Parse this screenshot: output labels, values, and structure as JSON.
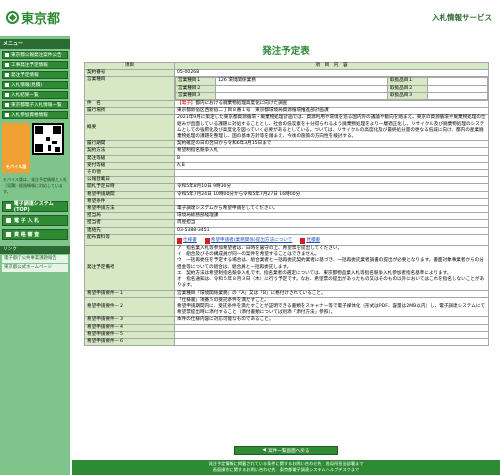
{
  "header": {
    "logo_text": "東京都",
    "service_title": "入札情報サービス"
  },
  "sidebar": {
    "menu_label": "メニュー",
    "items": [
      {
        "label": "東京都公報発注案件公告"
      },
      {
        "label": "工事発注予定情報"
      },
      {
        "label": "発注予定情報"
      },
      {
        "label": "入札情報(見積)"
      },
      {
        "label": "入札結果一覧"
      },
      {
        "label": "東京都電子入札情報一覧"
      },
      {
        "label": "入札参加資格情報"
      }
    ],
    "mobile_label": "モバイル版",
    "qr_note": "モバイル版は、発注予定情報と入札（見積）経過情報に対応しています。",
    "big_buttons": [
      "電子調達システム(TOP)",
      "電 子 入 札",
      "資 格 審 査"
    ],
    "link_head": "リンク",
    "links": [
      "電子都庁公共事業課題報告",
      "東京都公式ホームページ"
    ]
  },
  "main": {
    "title": "発注予定表",
    "col_item": "項目",
    "col_content": "項　目　内　容",
    "rows": {
      "contract_no": {
        "label": "契約番号",
        "value": "05-00268"
      },
      "business_type": {
        "label": "営業種目",
        "cells": [
          {
            "lbl": "営業種目１",
            "val": "126 環境関係業務",
            "lbl2": "取扱品目１",
            "val2": ""
          },
          {
            "lbl": "営業種目２",
            "val": "",
            "lbl2": "取扱品目２",
            "val2": ""
          },
          {
            "lbl": "営業種目３",
            "val": "",
            "lbl2": "取扱品目３",
            "val2": ""
          }
        ]
      },
      "subject": {
        "label": "件　名",
        "tag": "【電子】",
        "value": "都内における廃棄物処理高度化に向けた調査"
      },
      "location": {
        "label": "履行場所",
        "value": "東京都新宿区西新宿二丁目８番１号　東京都環境局資源循環推進部計画課"
      },
      "overview": {
        "label": "概要",
        "value": "2021年9月に策定した東京都資源循環・廃棄物処理計画では、資源利用や環境を巡る国内外の議論や動向を踏まえ、東京の資源循環や廃棄物処理の仕組みが直面している課題に対処することとし、社会の低炭素を十分得られるよう廃棄物処理をより一層適正化し、リサイクル及び廃棄物処理のシステムとしての強靭化及び高度化を図っていく必要があるとしている。ついては、リサイクルの高度化及び最終処分量の更なる低減に向け、都内の産業廃棄物処理の課題を整理し、国の基本方針等を踏まえ、今後の施策の方向性を検討する。"
      },
      "period": {
        "label": "履行期間",
        "value": "契約確定の日の翌日から令和6年3月15日まで"
      },
      "method": {
        "label": "契約方法",
        "value": "希望制指名競争入札"
      },
      "rank": {
        "label": "発注等級",
        "value": "B"
      },
      "accept_rank": {
        "label": "受付等級",
        "value": "A,B"
      },
      "other": {
        "label": "その他",
        "value": ""
      },
      "pub_date": {
        "label": "公報登載日",
        "value": ""
      },
      "open_date": {
        "label": "開札予定日時",
        "value": "令和5年8月10日 9時30分"
      },
      "apply_period": {
        "label": "希望申請期間",
        "value": "令和5年7月24日 10時00分から令和5年7月27日 16時00分"
      },
      "apply_cond": {
        "label": "希望条件",
        "value": ""
      },
      "apply_method": {
        "label": "希望申請方法",
        "value": "電子調達システムから希望申請をしてください。"
      },
      "dept": {
        "label": "担当局",
        "value": "環境局総務部経理課"
      },
      "person": {
        "label": "担当者",
        "value": "周屋担当"
      },
      "tel": {
        "label": "連絡先",
        "value": "03-5388-3451"
      },
      "docs": {
        "label": "配布資料等",
        "files": [
          "仕様書",
          "希望申請者(業務関係)提出方法について",
          "見積書"
        ]
      },
      "notes": {
        "label": "発注予定備考",
        "value": "ア　指名業入札等参加希望者は、日時を厳守の上、希望票を提出してください。\nイ　組合及びその構成員が同一の案件を希望することはできません。\nウ　一括再委任を予定する場合は、組合業者と一括再委託契約業者に基づき、一括再委託業者調書の提出が必要となります。書面対象事業者からの分担金等についての組合は、組合員と一括再委託します。\nエ　契約方法は希望制指名競争入札です。指名業者の選定については、東京都物品業入札等指名競争入札参加者指名基準によります。\nオ　指名通知は、令和５年８月３日（木）に行う予定です。なお、希望票の提出があったもの又はそのもの以外においてはこれを指名しないことがあります。"
      },
      "apply_req1": {
        "label": "希望申請要件－１",
        "value": "営業種目「環境関係業務」の「A」又は「B」に格付けされていること。"
      },
      "apply_req2": {
        "label": "希望申請要件－２",
        "value": "「仕様書」項番５の受託条件を満たすこと。\n希望申請期間内に、受託条件を満たすことが証明できる書類をスキャナー等で電子媒体化（形式はPDF、容量は2MB以内）し、電子調達システムにて希望票提出時に添付すること（添付書類については別添「添付方法」参照）。"
      },
      "apply_req3": {
        "label": "希望申請要件－３",
        "value": "本件の仕様内容に対応可能なものであること。"
      },
      "apply_req4": {
        "label": "希望申請要件－４",
        "value": ""
      },
      "apply_req5": {
        "label": "希望申請要件－５",
        "value": ""
      },
      "apply_req6": {
        "label": "希望申請要件－６",
        "value": ""
      }
    },
    "back_button": "案件一覧画面へ戻る",
    "footer_lines": [
      "発注予定情報に掲載されている条件に関するお問い合わせ先　各局所担当部署まで",
      "画面操作に関するお問い合わせ先　東京都電子調達システムヘルプデスクまで"
    ]
  }
}
